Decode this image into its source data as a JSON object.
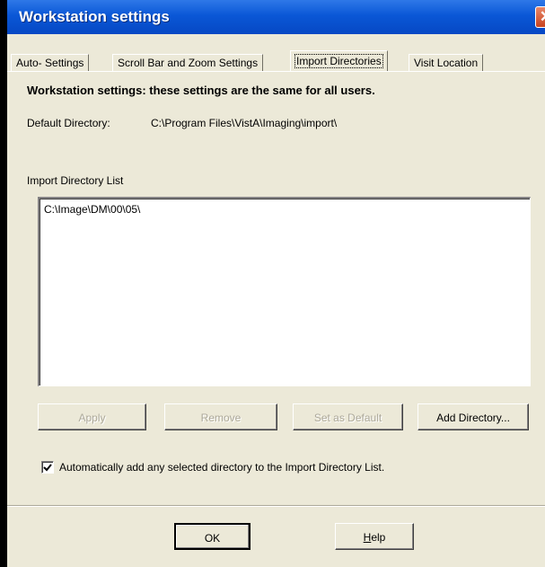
{
  "window": {
    "title": "Workstation settings",
    "close_glyph": "✕"
  },
  "tabs": [
    {
      "label": "Auto- Settings",
      "active": false
    },
    {
      "label": "Scroll Bar and Zoom Settings",
      "active": false
    },
    {
      "label": "Import Directories",
      "active": true
    },
    {
      "label": "Visit Location",
      "active": false
    }
  ],
  "content": {
    "heading": "Workstation settings: these settings are the same for all users.",
    "default_dir_label": "Default Directory:",
    "default_dir_value": "C:\\Program Files\\VistA\\Imaging\\import\\",
    "list_label": "Import Directory List",
    "list_items": [
      "C:\\Image\\DM\\00\\05\\"
    ]
  },
  "buttons": {
    "apply": "Apply",
    "remove": "Remove",
    "set_default": "Set as Default",
    "add_directory": "Add Directory...",
    "ok": "OK",
    "help_prefix": "H",
    "help_rest": "elp"
  },
  "checkbox": {
    "checked": true,
    "label": "Automatically add any selected directory to the Import Directory List."
  }
}
